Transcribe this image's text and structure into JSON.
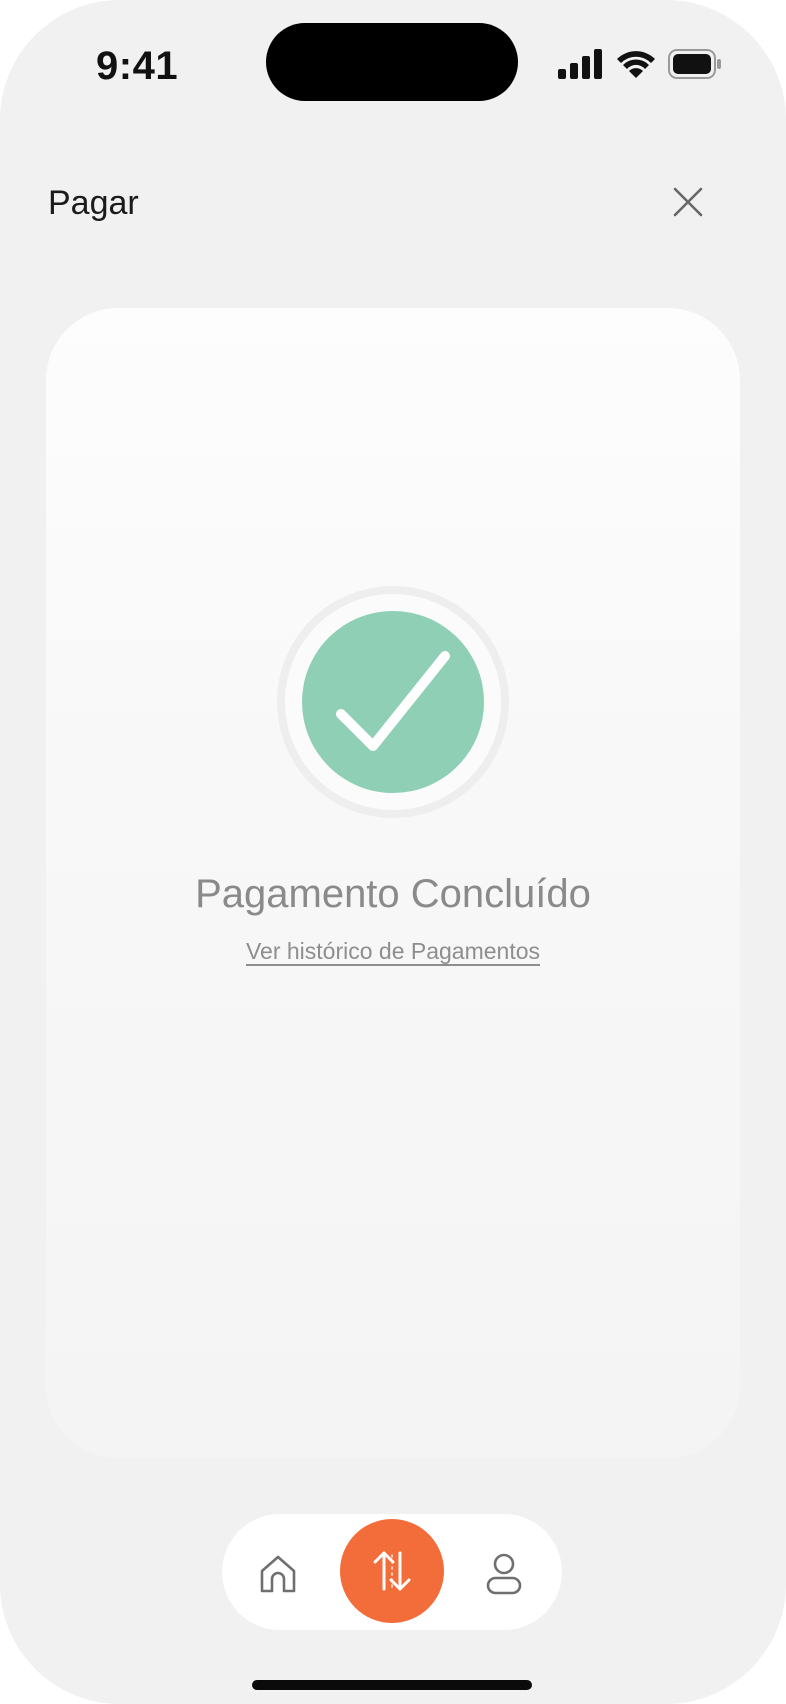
{
  "status_bar": {
    "time": "9:41",
    "icons": [
      "cellular-signal-icon",
      "wifi-icon",
      "battery-icon"
    ]
  },
  "header": {
    "title": "Pagar",
    "close_icon": "close-icon"
  },
  "result": {
    "icon": "check-circle-icon",
    "title": "Pagamento Concluído",
    "history_link": "Ver histórico de Pagamentos"
  },
  "bottom_nav": {
    "items": [
      {
        "icon": "home-icon",
        "active": false
      },
      {
        "icon": "transfer-arrows-icon",
        "active": true
      },
      {
        "icon": "profile-icon",
        "active": false
      }
    ]
  },
  "colors": {
    "accent": "#f36d3a",
    "success": "#8ecfb6",
    "background": "#f1f1f1"
  }
}
